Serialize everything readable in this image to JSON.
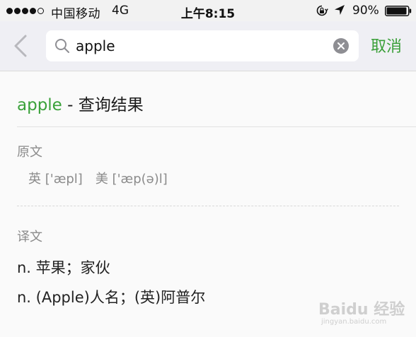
{
  "status_bar": {
    "carrier": "中国移动",
    "network": "4G",
    "time": "上午8:15",
    "battery": "90%"
  },
  "search": {
    "value": "apple",
    "cancel_label": "取消"
  },
  "result": {
    "query": "apple",
    "title_suffix": " - 查询结果",
    "source_label": "原文",
    "pron_uk": "英 ['æpl]",
    "pron_us": "美 ['æp(ə)l]",
    "translation_label": "译文",
    "definitions": [
      "n. 苹果；家伙",
      "n. (Apple)人名；(英)阿普尔"
    ]
  },
  "watermark": {
    "logo": "Baidu 经验",
    "url": "jingyan.baidu.com"
  },
  "colors": {
    "accent": "#3a9f38",
    "muted": "#8b8b8b"
  }
}
